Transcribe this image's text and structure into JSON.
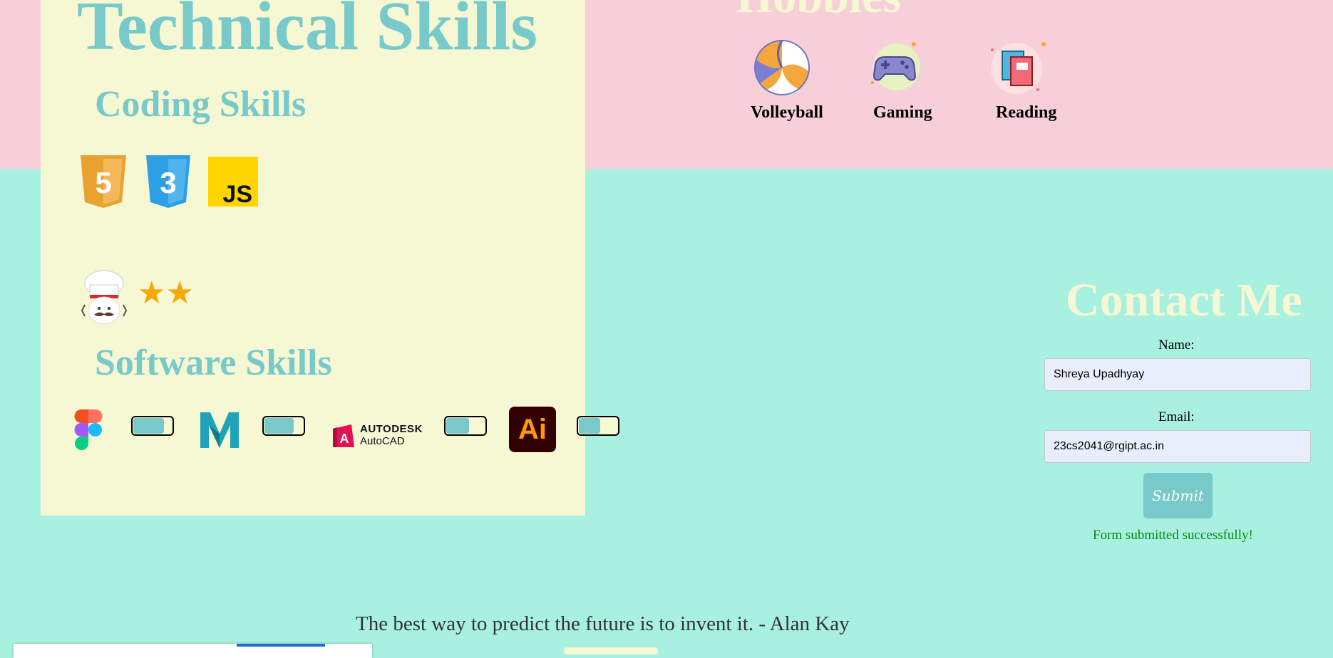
{
  "skills": {
    "title": "Technical Skills",
    "coding_title": "Coding Skills",
    "coding_logos": [
      {
        "label": "5",
        "icon": "html5-icon",
        "color": "#e9a232"
      },
      {
        "label": "3",
        "icon": "css3-icon",
        "color": "#2d9fe5"
      },
      {
        "label": "JS",
        "icon": "javascript-icon",
        "color": "#ffd600"
      }
    ],
    "chef_icon": "chef-icon",
    "stars": [
      "★",
      "★"
    ],
    "software_title": "Software Skills",
    "software": [
      {
        "icon": "figma-icon",
        "level": 0.8
      },
      {
        "icon": "maya-icon",
        "level": 0.75,
        "label": "M"
      },
      {
        "icon": "autocad-icon",
        "level": 0.6,
        "brand": "AUTODESK",
        "product": "AutoCAD"
      },
      {
        "icon": "illustrator-icon",
        "level": 0.55,
        "label": "Ai"
      }
    ]
  },
  "hobbies": {
    "title": "Hobbies",
    "items": [
      {
        "label": "Volleyball",
        "icon": "volleyball-icon"
      },
      {
        "label": "Gaming",
        "icon": "gamepad-icon"
      },
      {
        "label": "Reading",
        "icon": "books-icon"
      }
    ]
  },
  "contact": {
    "title": "Contact Me",
    "name_label": "Name:",
    "name_value": "Shreya Upadhyay",
    "email_label": "Email:",
    "email_value": "23cs2041@rgipt.ac.in",
    "submit_label": "Submit",
    "success_message": "Form submitted successfully!"
  },
  "quote": "The best way to predict the future is to invent it. - Alan Kay",
  "colors": {
    "background": "#a8f1e1",
    "pink_band": "#f7cfd8",
    "panel": "#f5f8d3",
    "accent": "#78c9c9",
    "success": "#0a8a0a"
  }
}
